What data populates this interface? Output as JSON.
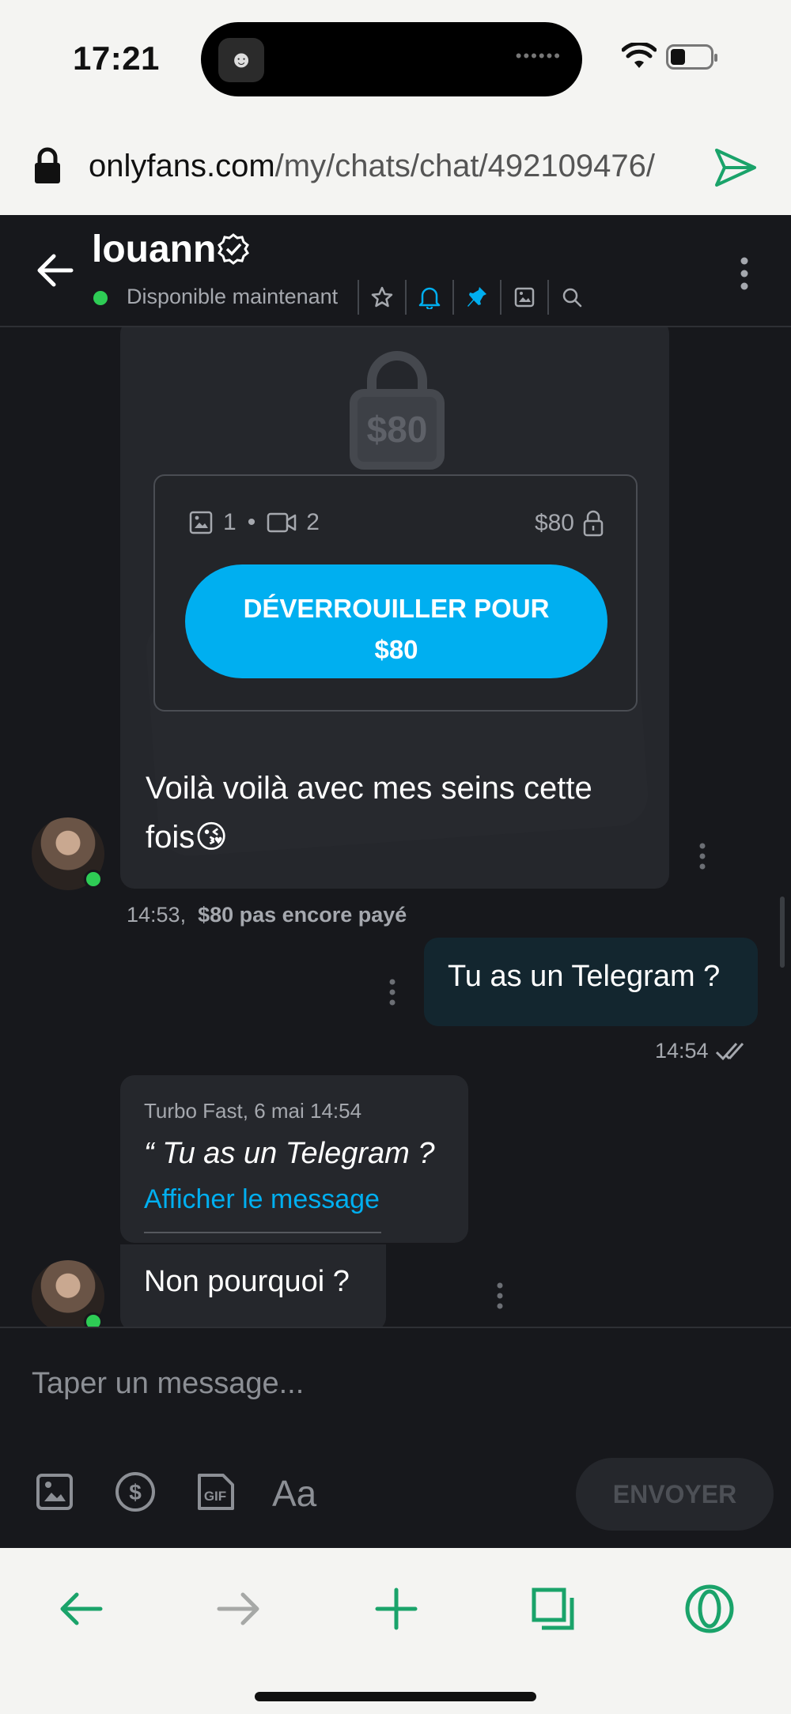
{
  "status_bar": {
    "time": "17:21"
  },
  "browser": {
    "url_domain": "onlyfans.com",
    "url_path": "/my/chats/chat/492109476/"
  },
  "header": {
    "name": "louann",
    "status": "Disponible maintenant"
  },
  "messages": {
    "ppv": {
      "lock_price": "$80",
      "image_count": "1",
      "separator": "•",
      "video_count": "2",
      "price": "$80",
      "unlock_label_line1": "DÉVERROUILLER POUR",
      "unlock_label_line2": "$80",
      "caption": "Voilà voilà avec mes seins cette fois😘",
      "time": "14:53,",
      "payment_status": "$80 pas encore payé"
    },
    "outgoing": {
      "text": "Tu as un Telegram ?",
      "time": "14:54"
    },
    "reply": {
      "header": "Turbo Fast, 6 mai 14:54",
      "quote": "“ Tu as un Telegram ?",
      "link": "Afficher le message",
      "text": "Non pourquoi ?"
    }
  },
  "composer": {
    "placeholder": "Taper un message...",
    "text_format_label": "Aa",
    "send_label": "ENVOYER"
  },
  "colors": {
    "accent": "#00aff0",
    "online": "#2ecc55",
    "browser_green": "#1aa36a",
    "background": "#17181c"
  }
}
